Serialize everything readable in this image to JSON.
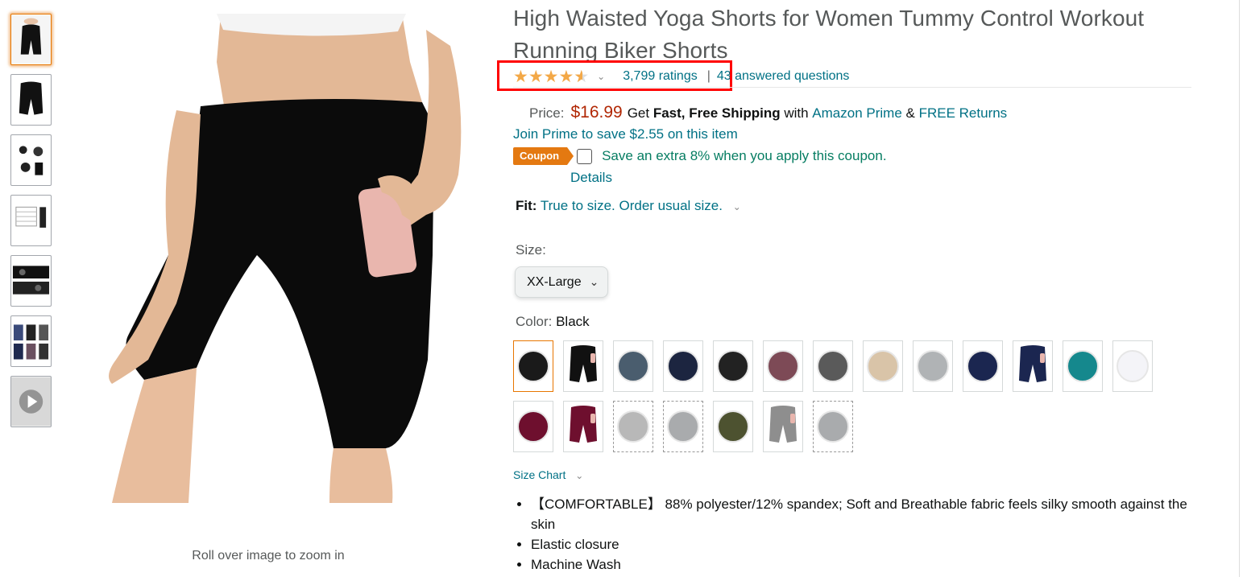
{
  "product": {
    "title": "High Waisted Yoga Shorts for Women Tummy Control Workout Running Biker Shorts",
    "rating_value": 4.5,
    "ratings_text": "3,799 ratings",
    "separator": "|",
    "answered_questions": "43 answered questions",
    "zoom_hint": "Roll over image to zoom in"
  },
  "price": {
    "label": "Price:",
    "amount": "$16.99",
    "get": "Get",
    "shipping": "Fast, Free Shipping",
    "with": "with",
    "prime": "Amazon Prime",
    "amp": "&",
    "returns": "FREE Returns",
    "join_prime": "Join Prime to save $2.55 on this item"
  },
  "coupon": {
    "badge": "Coupon",
    "text": "Save an extra 8% when you apply this coupon.",
    "details": "Details"
  },
  "fit": {
    "label": "Fit:",
    "value": "True to size. Order usual size."
  },
  "size": {
    "label": "Size:",
    "selected": "XX-Large"
  },
  "color": {
    "label": "Color:",
    "selected": "Black",
    "swatches": [
      {
        "name": "black",
        "color": "#1a1a1a"
      },
      {
        "name": "black-pocket",
        "color": "#111111"
      },
      {
        "name": "camo",
        "color": "#4a5d6e"
      },
      {
        "name": "navy-camo",
        "color": "#1c2540"
      },
      {
        "name": "black-camo",
        "color": "#222222"
      },
      {
        "name": "mauve",
        "color": "#7d4a56"
      },
      {
        "name": "charcoal",
        "color": "#5a5a5a"
      },
      {
        "name": "leopard",
        "color": "#d9c4a8"
      },
      {
        "name": "light-grey",
        "color": "#b0b3b5"
      },
      {
        "name": "navy",
        "color": "#1b2650"
      },
      {
        "name": "navy-pocket",
        "color": "#1b2650"
      },
      {
        "name": "teal",
        "color": "#15888d"
      },
      {
        "name": "white",
        "color": "#f4f4f8"
      },
      {
        "name": "burgundy",
        "color": "#6e0f2e"
      },
      {
        "name": "burgundy-pocket",
        "color": "#6e0f2e"
      },
      {
        "name": "grey-unavailable-1",
        "color": "#b8b8b8"
      },
      {
        "name": "grey-unavailable-2",
        "color": "#a9abad"
      },
      {
        "name": "olive",
        "color": "#4d5230"
      },
      {
        "name": "grey-pocket",
        "color": "#8e8e8e"
      },
      {
        "name": "grey-unavailable-3",
        "color": "#a9abad"
      }
    ]
  },
  "size_chart": "Size Chart",
  "bullets": [
    "【COMFORTABLE】 88% polyester/12% spandex; Soft and Breathable fabric feels silky smooth against the skin",
    "Elastic closure",
    "Machine Wash"
  ],
  "colors": {
    "accent_orange": "#e47911",
    "price_red": "#b12704",
    "link_teal": "#007185",
    "coupon_green": "#067d62",
    "highlight_red": "#ff0000"
  }
}
